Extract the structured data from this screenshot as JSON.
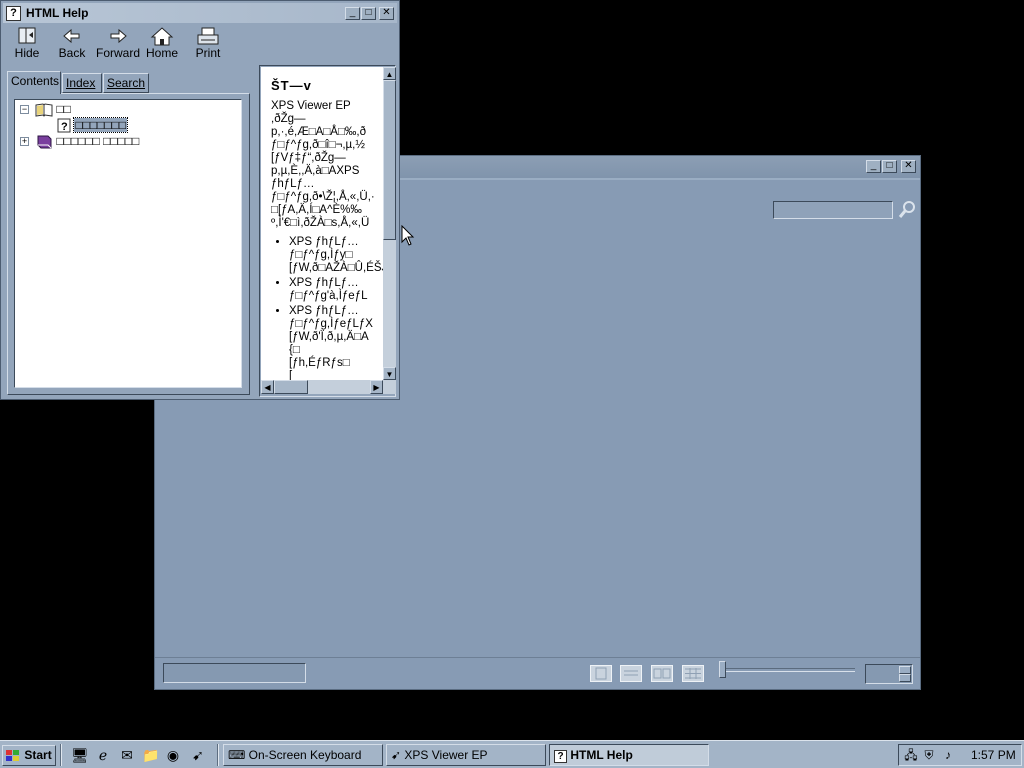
{
  "help_window": {
    "title": "HTML Help",
    "toolbar": [
      {
        "label": "Hide",
        "icon": "hide-icon"
      },
      {
        "label": "Back",
        "icon": "back-arrow-icon"
      },
      {
        "label": "Forward",
        "icon": "forward-arrow-icon"
      },
      {
        "label": "Home",
        "icon": "home-icon"
      },
      {
        "label": "Print",
        "icon": "printer-icon"
      }
    ],
    "tabs": [
      "Contents",
      "Index",
      "Search"
    ],
    "tree": [
      {
        "label": "□□",
        "icon": "open-book-icon",
        "expanded": true
      },
      {
        "label": "□□□□□□□",
        "icon": "help-page-icon",
        "selected": true
      },
      {
        "label": "□□□□□□ □□□□□",
        "icon": "closed-book-icon",
        "expanded": false
      }
    ],
    "content": {
      "heading": "ŠT—v",
      "paragraph_lines": [
        "XPS Viewer EP",
        ",ðŽg—",
        "p,·,é,Æ□A□Å□‰,ð",
        "ƒ□ƒ^ƒg,ð□î□¬,µ,½",
        "[ƒVƒ‡ƒ“,ðŽg—",
        "p,µ,È,,Ä,à□AXPS",
        "ƒhƒLƒ…",
        "ƒ□ƒ^ƒg,ð•\\Ž¦,Å,«,Ü,·",
        "□[ƒA,Ä,Í□A^È%‰",
        "º,Ì'€□ì,ðŽÀ□s,Å,«,Ü"
      ],
      "bullets": [
        [
          "XPS ƒhƒLƒ…",
          "ƒ□ƒ^ƒg,Ìƒy□",
          "[ƒW,ð□AŽÀ□Û,ÉŠJ"
        ],
        [
          "XPS ƒhƒLƒ…",
          "ƒ□ƒ^ƒg'à,ÌƒeƒL"
        ],
        [
          "XPS ƒhƒLƒ…",
          "ƒ□ƒ^ƒg,ÌƒeƒLƒX",
          "[ƒW,ð'Ï,ð,µ,Ä□A",
          "{□",
          "[ƒh,ÉƒRƒs□",
          "["
        ]
      ]
    },
    "controls": {
      "minimize": "_",
      "maximize": "□",
      "close": "✕"
    }
  },
  "xps_window": {
    "controls": {
      "minimize": "_",
      "maximize": "□",
      "close": "✕"
    },
    "search_placeholder": "",
    "search_icon": "magnifier-icon",
    "view_buttons": [
      "one-page-view-icon",
      "two-page-view-icon",
      "thumbnails-view-icon",
      "grid-view-icon"
    ]
  },
  "taskbar": {
    "start_label": "Start",
    "quick_launch": [
      "show-desktop-icon",
      "internet-explorer-icon",
      "outlook-express-icon",
      "windows-explorer-icon",
      "firefox-icon",
      "xps-viewer-icon"
    ],
    "tasks": [
      {
        "label": "On-Screen Keyboard",
        "icon": "keyboard-icon",
        "active": false
      },
      {
        "label": "XPS Viewer EP",
        "icon": "xps-viewer-icon",
        "active": false
      },
      {
        "label": "HTML Help",
        "icon": "help-icon",
        "active": true
      }
    ],
    "tray_icons": [
      "network-icon",
      "security-icon",
      "speaker-icon"
    ],
    "clock": "1:57 PM"
  },
  "colors": {
    "desktop": "#000000",
    "window_face": "#93a5bb",
    "xps_face": "#879bb4",
    "taskbar": "#a3b4c7"
  }
}
